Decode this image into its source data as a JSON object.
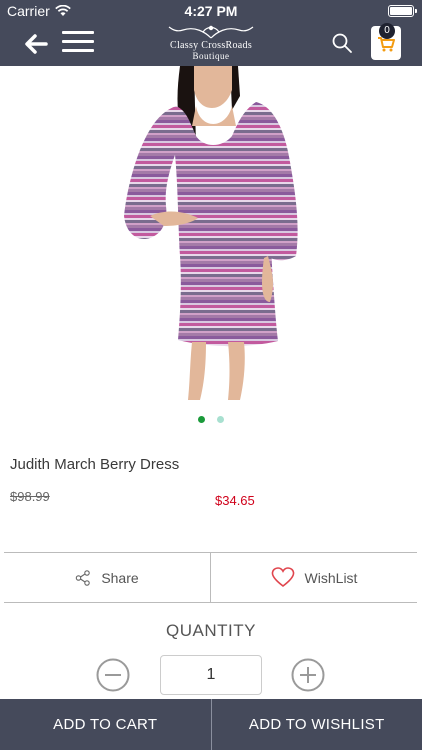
{
  "status": {
    "carrier": "Carrier",
    "time": "4:27 PM"
  },
  "header": {
    "logo_line1": "Classy CrossRoads",
    "logo_line2": "Boutique",
    "cart_count": "0"
  },
  "product": {
    "name": "Judith March Berry Dress",
    "old_price": "$98.99",
    "price": "$34.65",
    "image_count": 2,
    "active_image": 1
  },
  "actions": {
    "share": "Share",
    "wishlist": "WishList"
  },
  "quantity": {
    "label": "QUANTITY",
    "value": "1"
  },
  "footer": {
    "add_to_cart": "ADD TO CART",
    "add_to_wishlist": "ADD TO WISHLIST"
  },
  "colors": {
    "bar": "#454a5b",
    "price_red": "#d0021b",
    "dot_active": "#1a9a3a",
    "dot_inactive": "#a8e0d0",
    "heart": "#e0454d"
  }
}
